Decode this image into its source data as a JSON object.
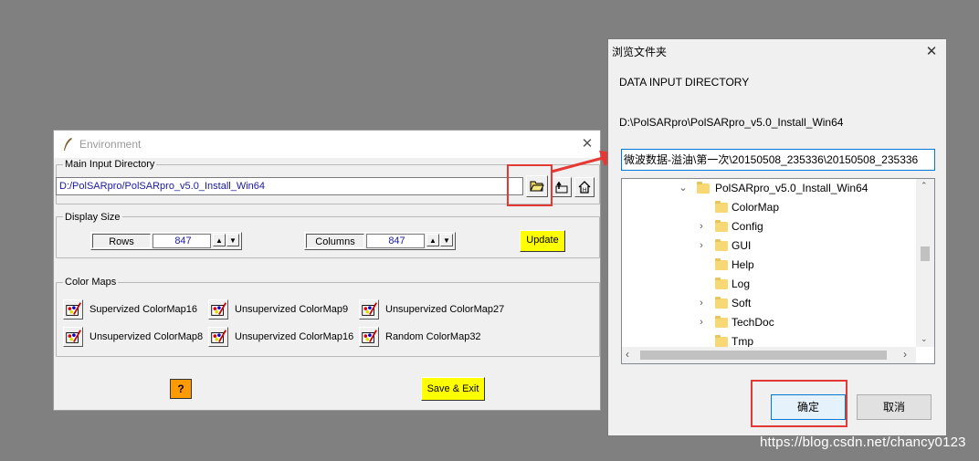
{
  "env": {
    "title": "Environment",
    "close": "✕",
    "main_dir": {
      "label": "Main Input Directory",
      "value": "D:/PolSARpro/PolSARpro_v5.0_Install_Win64"
    },
    "display": {
      "label": "Display Size",
      "rows_label": "Rows",
      "rows_value": "847",
      "cols_label": "Columns",
      "cols_value": "847",
      "update": "Update"
    },
    "colormaps": {
      "label": "Color Maps",
      "items": [
        "Supervized ColorMap16",
        "Unsupervized ColorMap9",
        "Unsupervized ColorMap27",
        "Unsupervized ColorMap8",
        "Unsupervized ColorMap16",
        "Random ColorMap32"
      ]
    },
    "help": "?",
    "save_exit": "Save & Exit"
  },
  "dialog": {
    "title": "浏览文件夹",
    "close": "✕",
    "heading": "DATA INPUT DIRECTORY",
    "current_path": "D:\\PolSARpro\\PolSARpro_v5.0_Install_Win64",
    "input_value": "微波数据-溢油\\第一次\\20150508_235336\\20150508_235336",
    "tree": {
      "root": "PolSARpro_v5.0_Install_Win64",
      "children": [
        {
          "name": "ColorMap",
          "expandable": false
        },
        {
          "name": "Config",
          "expandable": true
        },
        {
          "name": "GUI",
          "expandable": true
        },
        {
          "name": "Help",
          "expandable": false
        },
        {
          "name": "Log",
          "expandable": false
        },
        {
          "name": "Soft",
          "expandable": true
        },
        {
          "name": "TechDoc",
          "expandable": true
        },
        {
          "name": "Tmp",
          "expandable": false
        }
      ]
    },
    "ok": "确定",
    "cancel": "取消"
  },
  "watermark": "https://blog.csdn.net/chancy0123",
  "colors": {
    "highlight": "#e53935",
    "yellow": "#ffff00",
    "link": "#1a1aa0"
  }
}
